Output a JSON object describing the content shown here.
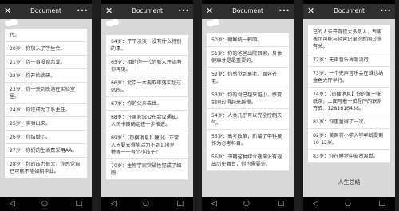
{
  "titlebar": {
    "close": "✕",
    "title": "Document",
    "more": "•••"
  },
  "nav": {
    "back": "◁",
    "home": "○",
    "recent": "□"
  },
  "panels": [
    {
      "rows": [
        "代。",
        "20岁：你加入了学生会。",
        "21岁：你一直没谈恋爱。",
        "22岁：你开始读研。",
        "23岁：你一天到晚泡在实验室里。",
        "24岁：你还成为了系主任。",
        "25岁：实验出来。",
        "26岁：你结婚了。",
        "27岁：你们的生活费采用AA。",
        "28岁：你的压力很大，你感觉自己可能不能如期毕业。"
      ]
    },
    {
      "rows": [
        "64岁：平平淡淡，没有什么特别的事。",
        "65岁：相的你一代的新人开始向你再见。",
        "66岁：北京一本要取率落实超过99%。",
        "67岁：你的父亲去世。",
        "68岁：在国宾馆公布会议通知。人民卡被确定进一步推进。",
        "69岁：【热搜消息】建设，正常人先要安得能活力不到100岁，特等一一有个小孩子？",
        "70岁：生物学家突破性完成了细胞"
      ]
    },
    {
      "rows": [
        "50岁：朝鲜统一韩国。",
        "51岁：你的爸爸出院回家，身体健康才是最重要的。",
        "52岁：你感觉到衰老，面容苍老。",
        "53岁：你的骨已越来越小，感觉到同过得越来越慢。",
        "54岁：人类几乎可以完全控制天气。",
        "55岁：高考改革，新增了中科技作为必考科目。",
        "56岁：书籍这种媒介逐渐没有退出历史舞台，你也需要外。"
      ]
    },
    {
      "rows": [
        "已的人去开奇怪大多数人。专家表示可能与经营记录的新闻过多有关。",
        "72岁：无声音乐界刚流行。",
        "73岁：一个无声音乐会在维也纳金色大厅举行。",
        "74岁：【热搜消息】你的第一张纸条，上面写着一位程序的联系方式：1281616438。",
        "81岁：你重量得了一次。",
        "82岁：美国将小学入学年龄提到10-12岁。",
        "83岁：你在睡梦中安然离世。"
      ],
      "summary": "人生总结"
    }
  ]
}
